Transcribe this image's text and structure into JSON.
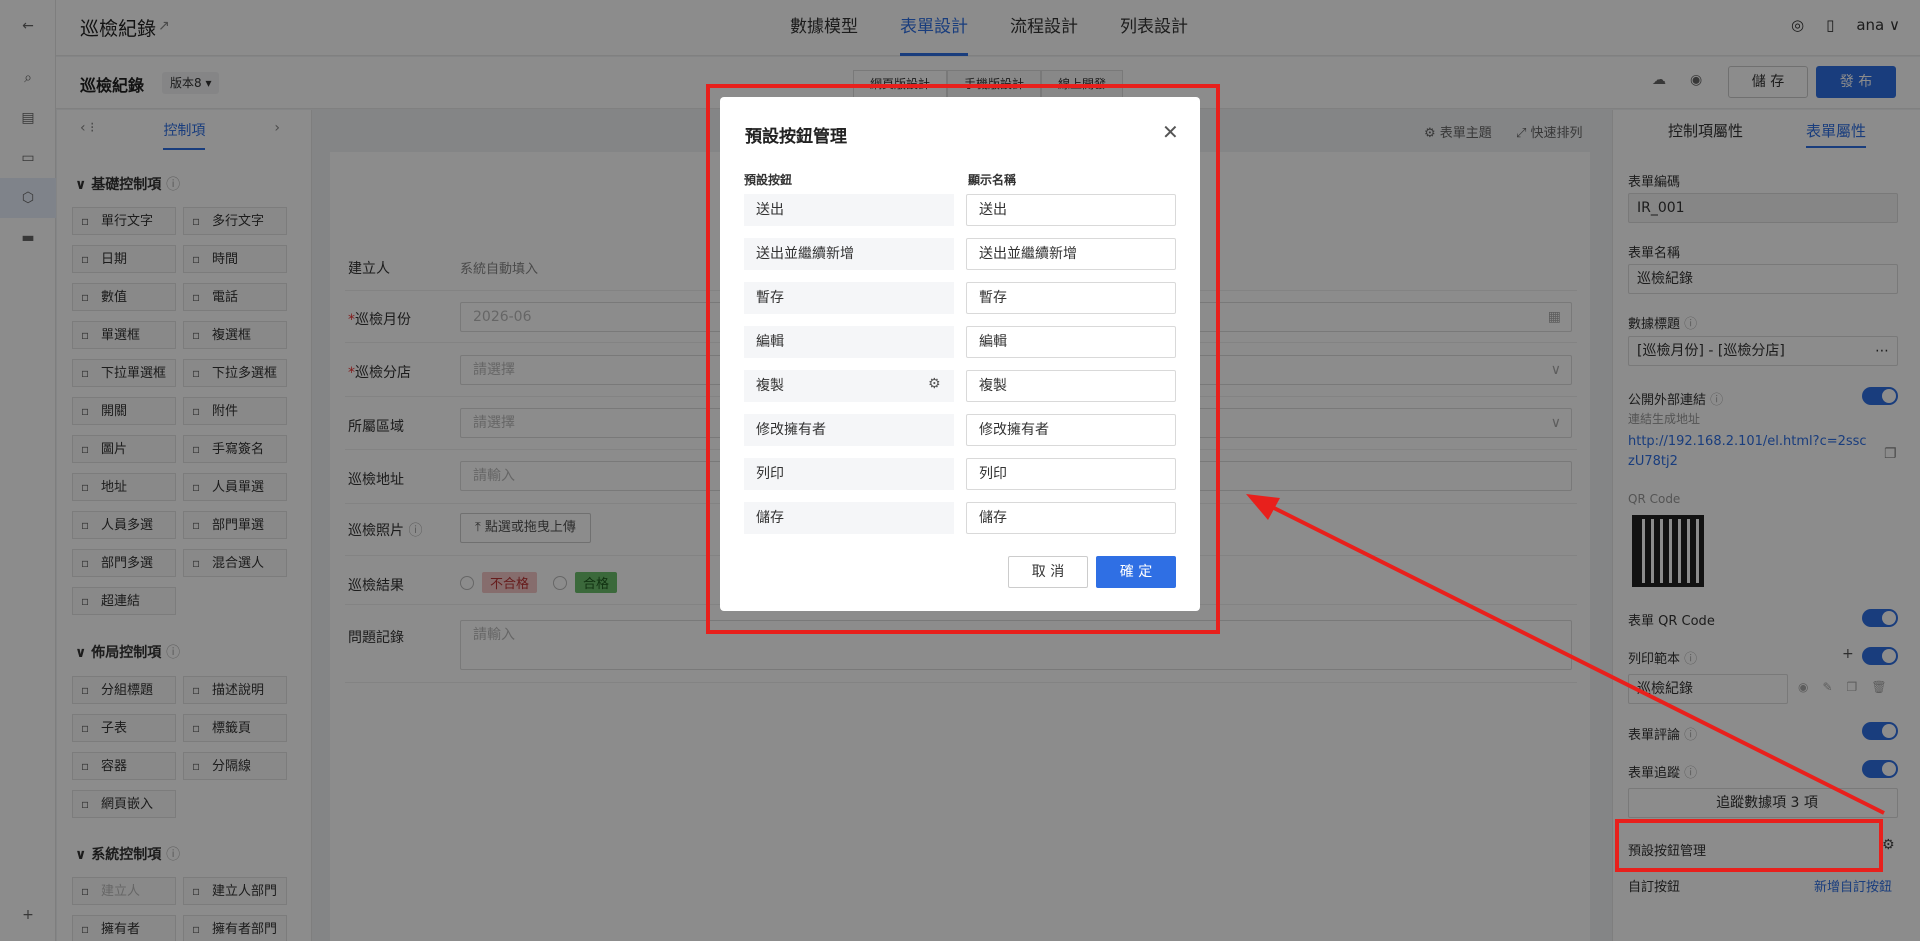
{
  "app": {
    "title": "巡檢紀錄"
  },
  "top_tabs": [
    "數據模型",
    "表單設計",
    "流程設計",
    "列表設計"
  ],
  "user": "ana",
  "form_bar": {
    "form_name": "巡檢紀錄",
    "version": "版本8",
    "device_tabs": [
      "網頁版設計",
      "手機版設計",
      "線上開發"
    ],
    "save": "儲 存",
    "publish": "發 布"
  },
  "left_panel": {
    "tab": "控制項",
    "basic_title": "基礎控制項",
    "basic": [
      "單行文字",
      "多行文字",
      "日期",
      "時間",
      "數值",
      "電話",
      "單選框",
      "複選框",
      "下拉單選框",
      "下拉多選框",
      "開關",
      "附件",
      "圖片",
      "手寫簽名",
      "地址",
      "人員單選",
      "人員多選",
      "部門單選",
      "部門多選",
      "混合選人",
      "超連結"
    ],
    "layout_title": "佈局控制項",
    "layout": [
      "分組標題",
      "描述說明",
      "子表",
      "標籤頁",
      "容器",
      "分隔線",
      "網頁嵌入"
    ],
    "system_title": "系統控制項",
    "system": [
      "建立人",
      "建立人部門",
      "擁有者",
      "擁有者部門"
    ]
  },
  "canvas": {
    "toolbar": [
      "表單主題",
      "快速排列"
    ],
    "fields": [
      {
        "label": "建立人",
        "value": "系統自動填入",
        "required": false
      },
      {
        "label": "巡檢月份",
        "value": "2026-06",
        "required": true
      },
      {
        "label": "巡檢分店",
        "value": "請選擇",
        "required": true
      },
      {
        "label": "所屬區域",
        "value": "請選擇",
        "required": false
      },
      {
        "label": "巡檢地址",
        "value": "請輸入",
        "required": false
      },
      {
        "label": "巡檢照片",
        "value": "點選或拖曳上傳",
        "required": false
      },
      {
        "label": "巡檢結果",
        "options": [
          "不合格",
          "合格"
        ],
        "required": false
      },
      {
        "label": "問題記錄",
        "value": "請輸入",
        "required": false
      }
    ]
  },
  "right_panel": {
    "tabs": [
      "控制項屬性",
      "表單屬性"
    ],
    "form_code_label": "表單編碼",
    "form_code": "IR_001",
    "form_name_label": "表單名稱",
    "form_name": "巡檢紀錄",
    "data_title_label": "數據標題",
    "data_title": "[巡檢月份] - [巡檢分店]",
    "public_link_label": "公開外部連結",
    "public_link_hint": "連結生成地址",
    "public_link_url": "http://192.168.2.101/el.html?c=2ssczU78tj2",
    "qr_label": "QR Code",
    "form_qr_label": "表單 QR Code",
    "print_label": "列印範本",
    "print_value": "巡檢紀錄",
    "comment_label": "表單評論",
    "track_label": "表單追蹤",
    "track_value": "追蹤數據項 3 項",
    "default_btn_label": "預設按鈕管理",
    "custom_btn_label": "自訂按鈕",
    "custom_btn_link": "新增自訂按鈕"
  },
  "modal": {
    "title": "預設按鈕管理",
    "col_left": "預設按鈕",
    "col_right": "顯示名稱",
    "rows": [
      {
        "name": "送出",
        "display": "送出"
      },
      {
        "name": "送出並繼續新增",
        "display": "送出並繼續新增"
      },
      {
        "name": "暫存",
        "display": "暫存"
      },
      {
        "name": "編輯",
        "display": "編輯"
      },
      {
        "name": "複製",
        "display": "複製"
      },
      {
        "name": "修改擁有者",
        "display": "修改擁有者"
      },
      {
        "name": "列印",
        "display": "列印"
      },
      {
        "name": "儲存",
        "display": "儲存"
      }
    ],
    "cancel": "取 消",
    "ok": "確 定"
  },
  "colors": {
    "accent": "#2f6fe4",
    "highlight": "#e8201c",
    "reject": "#f4c7c7",
    "pass": "#6cbf6c"
  }
}
